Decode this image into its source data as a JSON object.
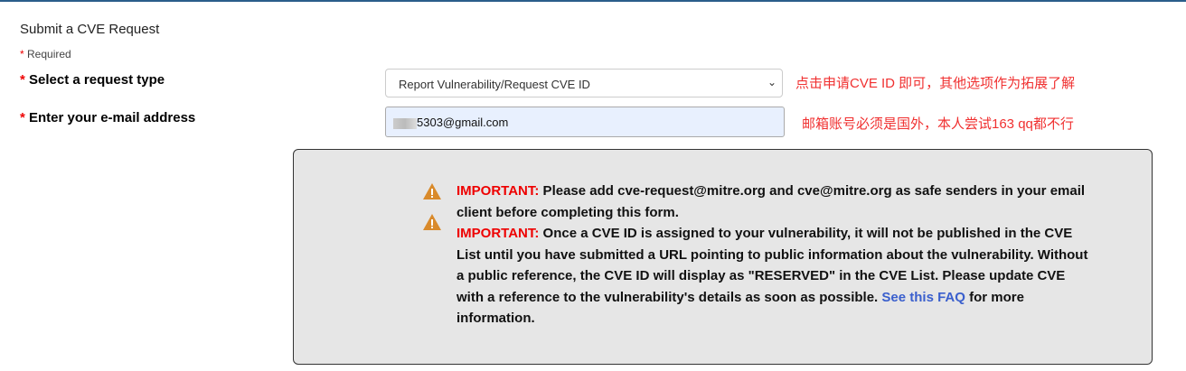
{
  "header": {
    "title": "Submit a CVE Request",
    "required_note": "Required",
    "asterisk": "*"
  },
  "form": {
    "request_type_label": "Select a request type",
    "request_type_value": "Report Vulnerability/Request CVE ID",
    "email_label": "Enter your e-mail address",
    "email_value": "5303@gmail.com"
  },
  "annotations": {
    "request_type_note": "点击申请CVE ID 即可，其他选项作为拓展了解",
    "email_note": "邮箱账号必须是国外，本人尝试163 qq都不行"
  },
  "notice": {
    "important_label": "IMPORTANT:",
    "text1": " Please add cve-request@mitre.org and cve@mitre.org as safe senders in your email client before completing this form.",
    "text2": " Once a CVE ID is assigned to your vulnerability, it will not be published in the CVE List until you have submitted a URL pointing to public information about the vulnerability. Without a public reference, the CVE ID will display as \"RESERVED\" in the CVE List. Please update CVE with a reference to the vulnerability's details as soon as possible. ",
    "faq_link": "See this FAQ",
    "text3": " for more information."
  },
  "colors": {
    "required": "#ee0000",
    "annotation": "#f03030",
    "link": "#3a5fcd",
    "warning": "#d98a2b"
  }
}
